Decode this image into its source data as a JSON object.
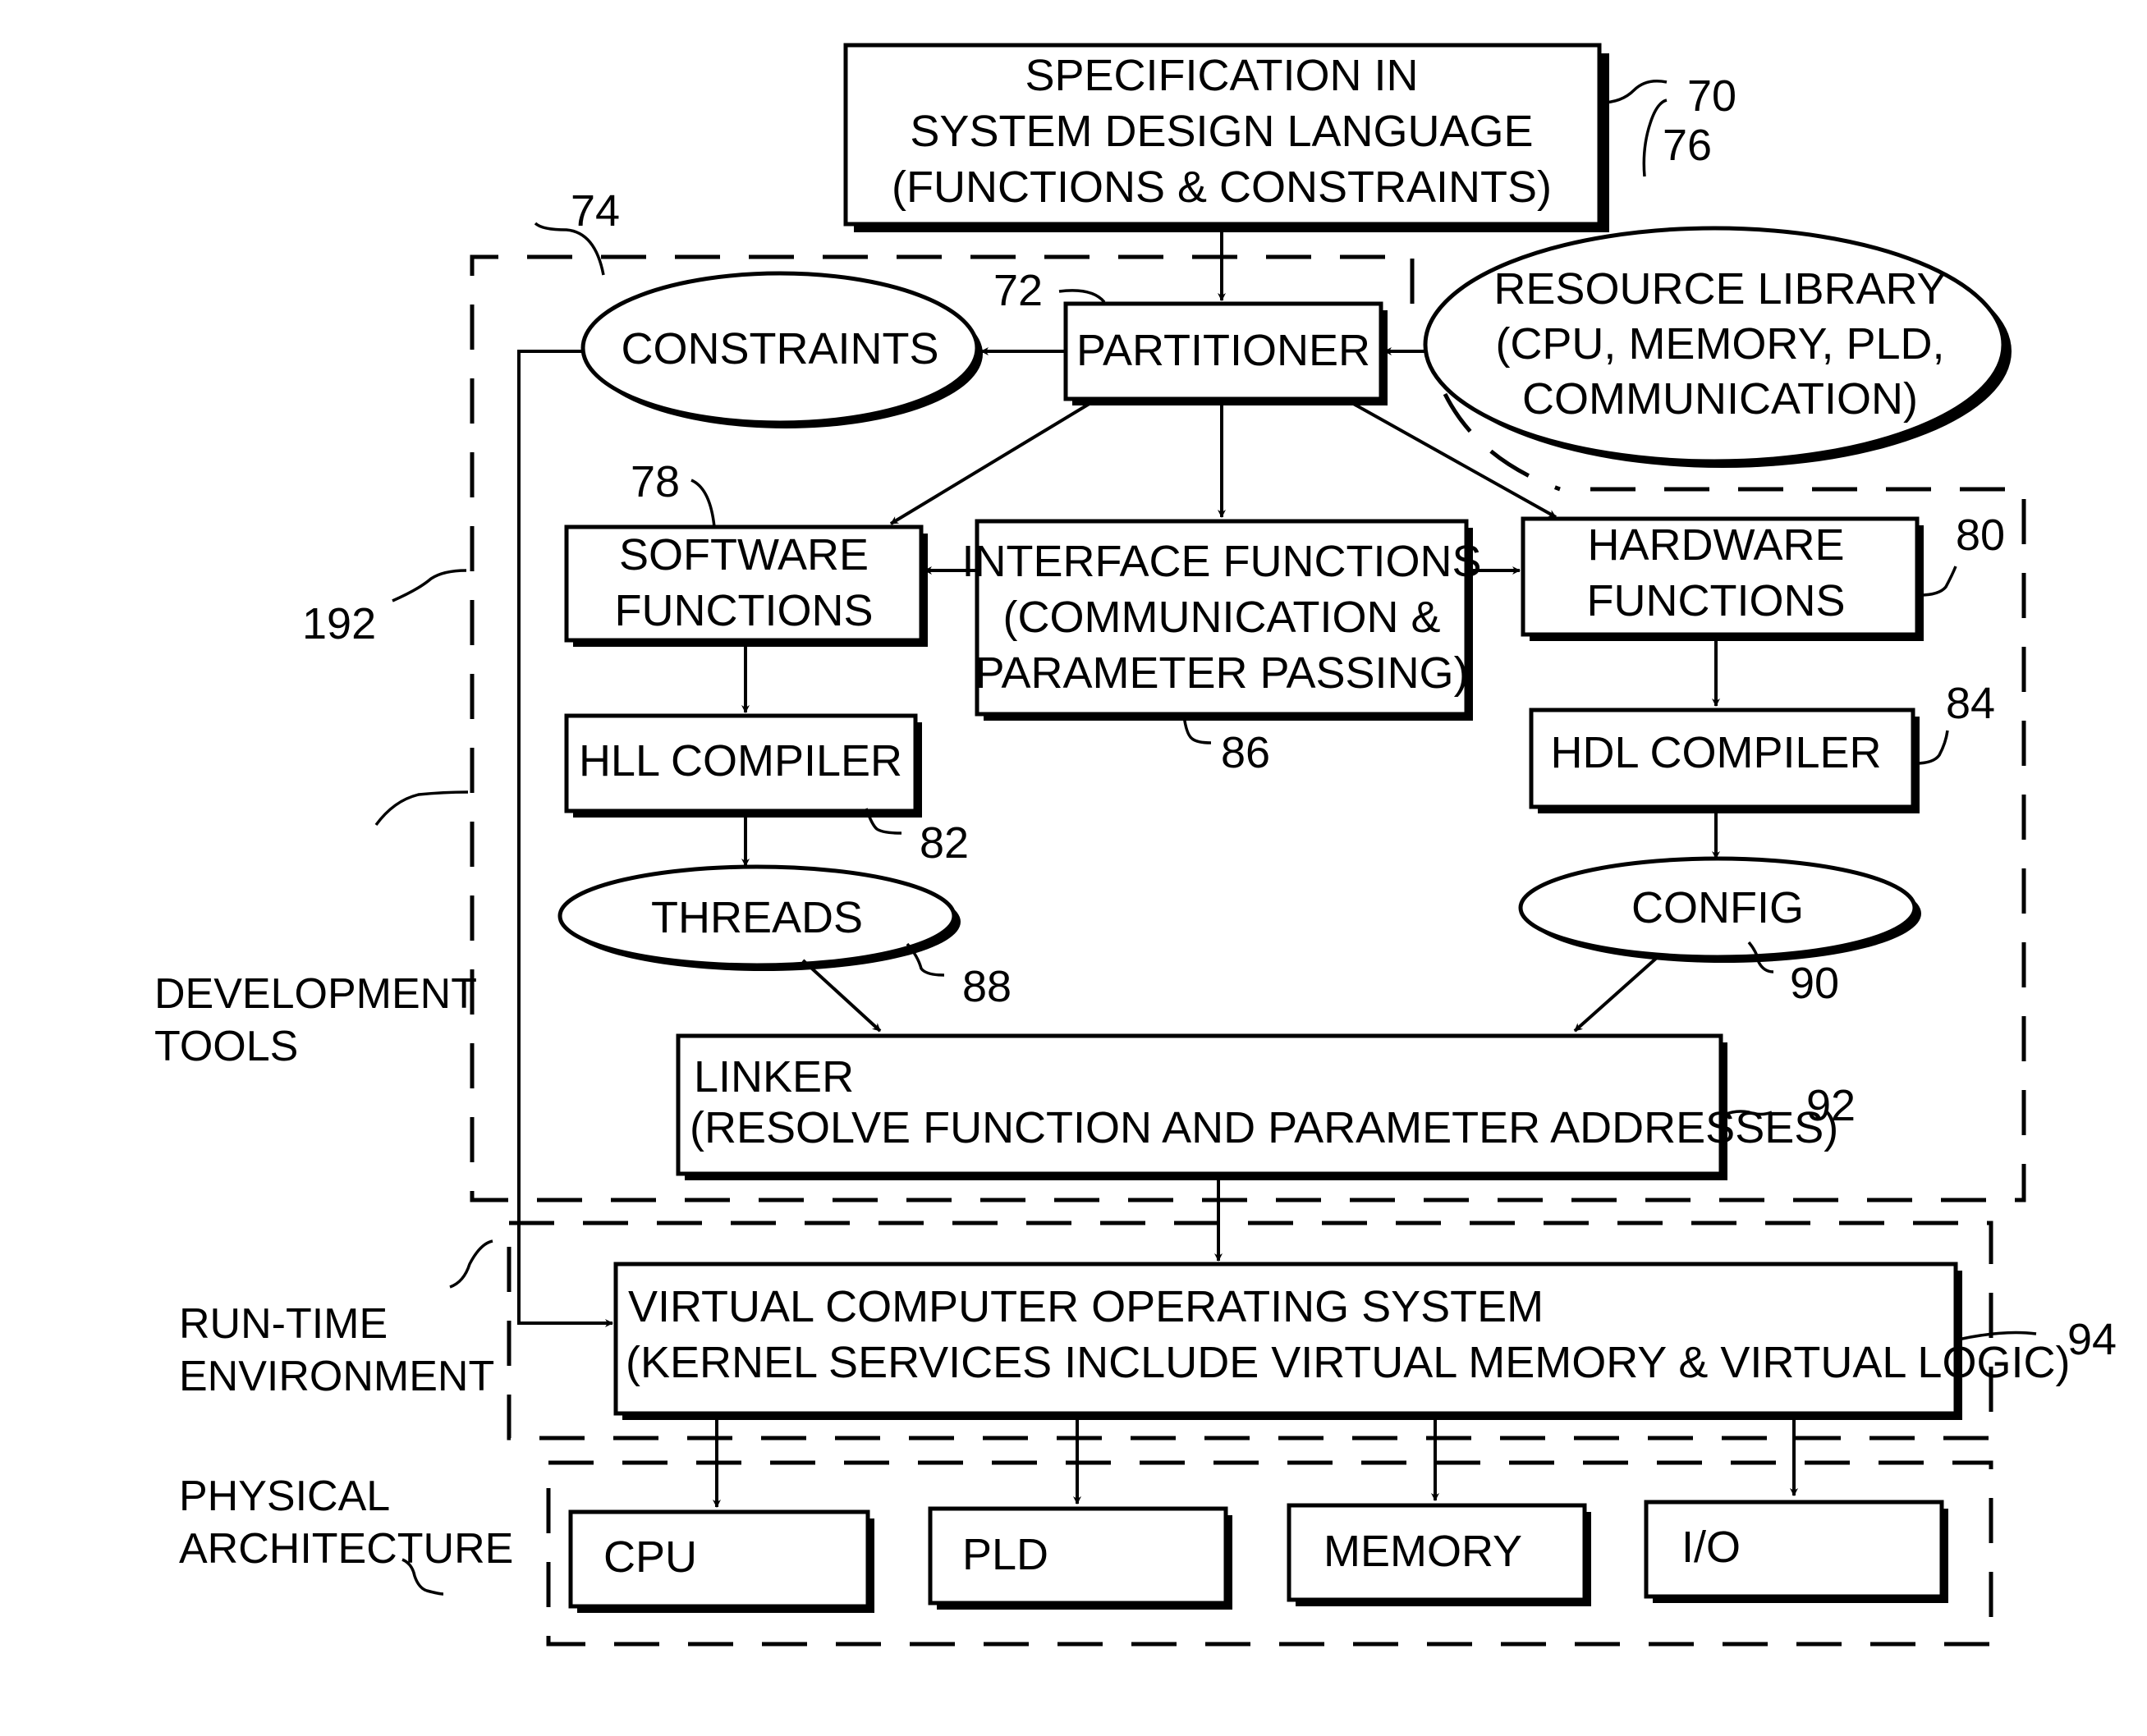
{
  "diagram": {
    "nodes": {
      "specification": {
        "ref": "70",
        "lines": [
          "SPECIFICATION IN",
          "SYSTEM DESIGN LANGUAGE",
          "(FUNCTIONS & CONSTRAINTS)"
        ]
      },
      "partitioner": {
        "ref": "72",
        "lines": [
          "PARTITIONER"
        ]
      },
      "constraints": {
        "ref": "74",
        "lines": [
          "CONSTRAINTS"
        ]
      },
      "resource_library": {
        "ref": "76",
        "lines": [
          "RESOURCE LIBRARY",
          "(CPU, MEMORY, PLD,",
          "COMMUNICATION)"
        ]
      },
      "software_functions": {
        "ref": "78",
        "lines": [
          "SOFTWARE",
          "FUNCTIONS"
        ]
      },
      "hardware_functions": {
        "ref": "80",
        "lines": [
          "HARDWARE",
          "FUNCTIONS"
        ]
      },
      "hll_compiler": {
        "ref": "82",
        "lines": [
          "HLL COMPILER"
        ]
      },
      "hdl_compiler": {
        "ref": "84",
        "lines": [
          "HDL COMPILER"
        ]
      },
      "interface_functions": {
        "ref": "86",
        "lines": [
          "INTERFACE FUNCTIONS",
          "(COMMUNICATION &",
          "PARAMETER PASSING)"
        ]
      },
      "threads": {
        "ref": "88",
        "lines": [
          "THREADS"
        ]
      },
      "config": {
        "ref": "90",
        "lines": [
          "CONFIG"
        ]
      },
      "linker": {
        "ref": "92",
        "lines": [
          "LINKER",
          "(RESOLVE FUNCTION AND PARAMETER ADDRESSES)"
        ]
      },
      "vcos": {
        "ref": "94",
        "lines": [
          "VIRTUAL COMPUTER OPERATING SYSTEM",
          "(KERNEL SERVICES INCLUDE VIRTUAL MEMORY & VIRTUAL LOGIC)"
        ]
      },
      "cpu": {
        "lines": [
          "CPU"
        ]
      },
      "pld": {
        "lines": [
          "PLD"
        ]
      },
      "memory": {
        "lines": [
          "MEMORY"
        ]
      },
      "io": {
        "lines": [
          "I/O"
        ]
      }
    },
    "regions": {
      "development_tools": {
        "ref": "192",
        "lines": [
          "DEVELOPMENT",
          "TOOLS"
        ]
      },
      "runtime_environment": {
        "lines": [
          "RUN-TIME",
          "ENVIRONMENT"
        ]
      },
      "physical_architecture": {
        "lines": [
          "PHYSICAL",
          "ARCHITECTURE"
        ]
      }
    },
    "edges": [
      {
        "from": "specification",
        "to": "partitioner"
      },
      {
        "from": "partitioner",
        "to": "constraints"
      },
      {
        "from": "resource_library",
        "to": "partitioner"
      },
      {
        "from": "partitioner",
        "to": "software_functions"
      },
      {
        "from": "partitioner",
        "to": "interface_functions"
      },
      {
        "from": "partitioner",
        "to": "hardware_functions"
      },
      {
        "from": "interface_functions",
        "to": "software_functions"
      },
      {
        "from": "interface_functions",
        "to": "hardware_functions"
      },
      {
        "from": "software_functions",
        "to": "hll_compiler"
      },
      {
        "from": "hll_compiler",
        "to": "threads"
      },
      {
        "from": "hardware_functions",
        "to": "hdl_compiler"
      },
      {
        "from": "hdl_compiler",
        "to": "config"
      },
      {
        "from": "threads",
        "to": "linker"
      },
      {
        "from": "config",
        "to": "linker"
      },
      {
        "from": "linker",
        "to": "vcos"
      },
      {
        "from": "constraints",
        "to": "vcos"
      },
      {
        "from": "vcos",
        "to": "cpu"
      },
      {
        "from": "vcos",
        "to": "pld"
      },
      {
        "from": "vcos",
        "to": "memory"
      },
      {
        "from": "vcos",
        "to": "io"
      }
    ]
  }
}
